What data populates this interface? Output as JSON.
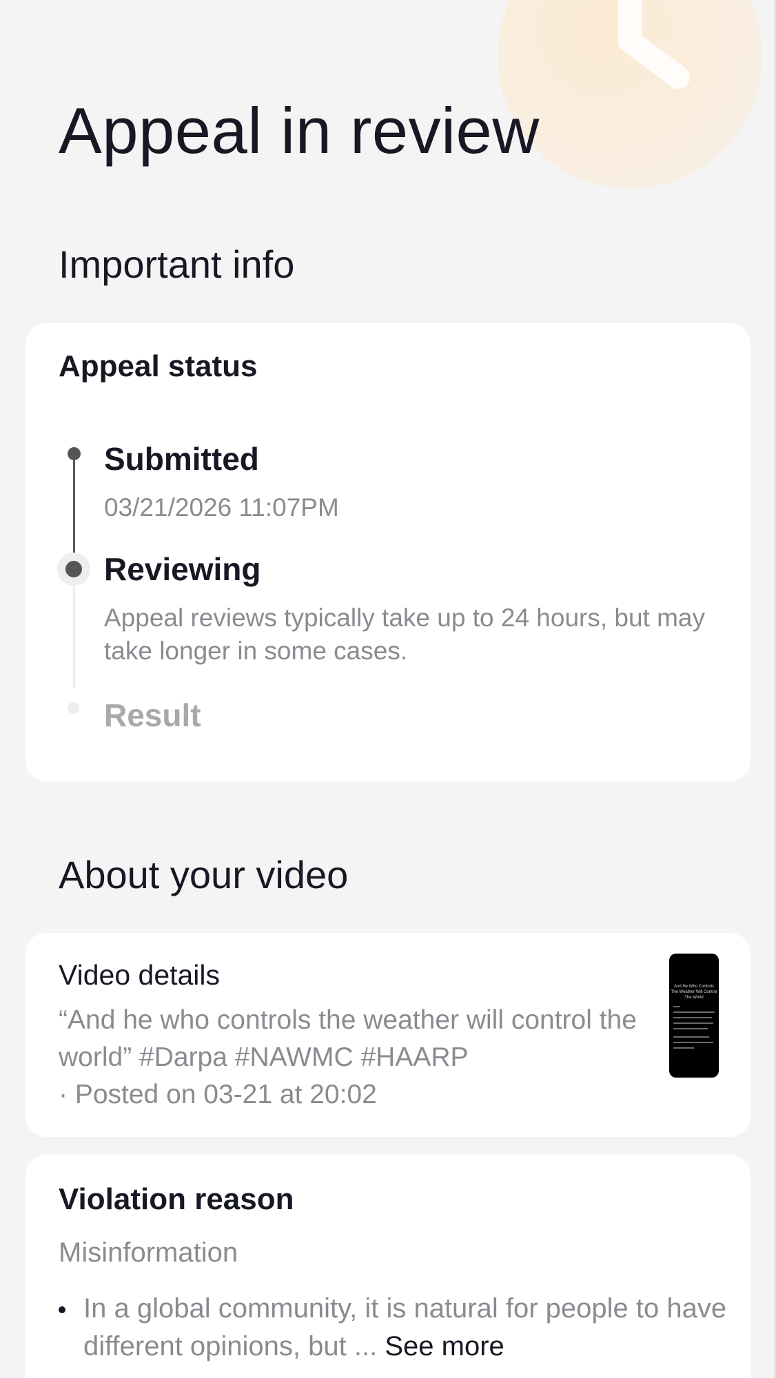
{
  "header": {
    "title": "Appeal in review"
  },
  "important_info": {
    "section_title": "Important info",
    "status_card": {
      "title": "Appeal status",
      "steps": [
        {
          "label": "Submitted",
          "detail": "03/21/2026 11:07PM",
          "state": "done"
        },
        {
          "label": "Reviewing",
          "detail": "Appeal reviews typically take up to 24 hours, but may take longer in some cases.",
          "state": "current"
        },
        {
          "label": "Result",
          "detail": "",
          "state": "pending"
        }
      ]
    }
  },
  "about_video": {
    "section_title": "About your video",
    "video_card": {
      "title": "Video details",
      "description": "“And he who controls the weather will control the world” #Darpa #NAWMC #HAARP",
      "posted": "· Posted on 03-21 at 20:02",
      "thumbnail_caption": "And He Who Controls The Weather Will Control The World"
    },
    "violation_card": {
      "title": "Violation reason",
      "reason": "Misinformation",
      "bullet_text": "In a global community, it is natural for people to have different opinions, but ...",
      "see_more_label": "See more"
    }
  },
  "colors": {
    "background": "#f4f4f5",
    "card": "#ffffff",
    "text_primary": "#161823",
    "text_secondary": "#8a8b91",
    "text_disabled": "#a8a9ad",
    "timeline_active": "#555555",
    "timeline_inactive": "#ececec",
    "clock_accent": "#fbe9d2"
  },
  "icons": {
    "back": "chevron-left-icon",
    "decoration": "clock-icon"
  }
}
